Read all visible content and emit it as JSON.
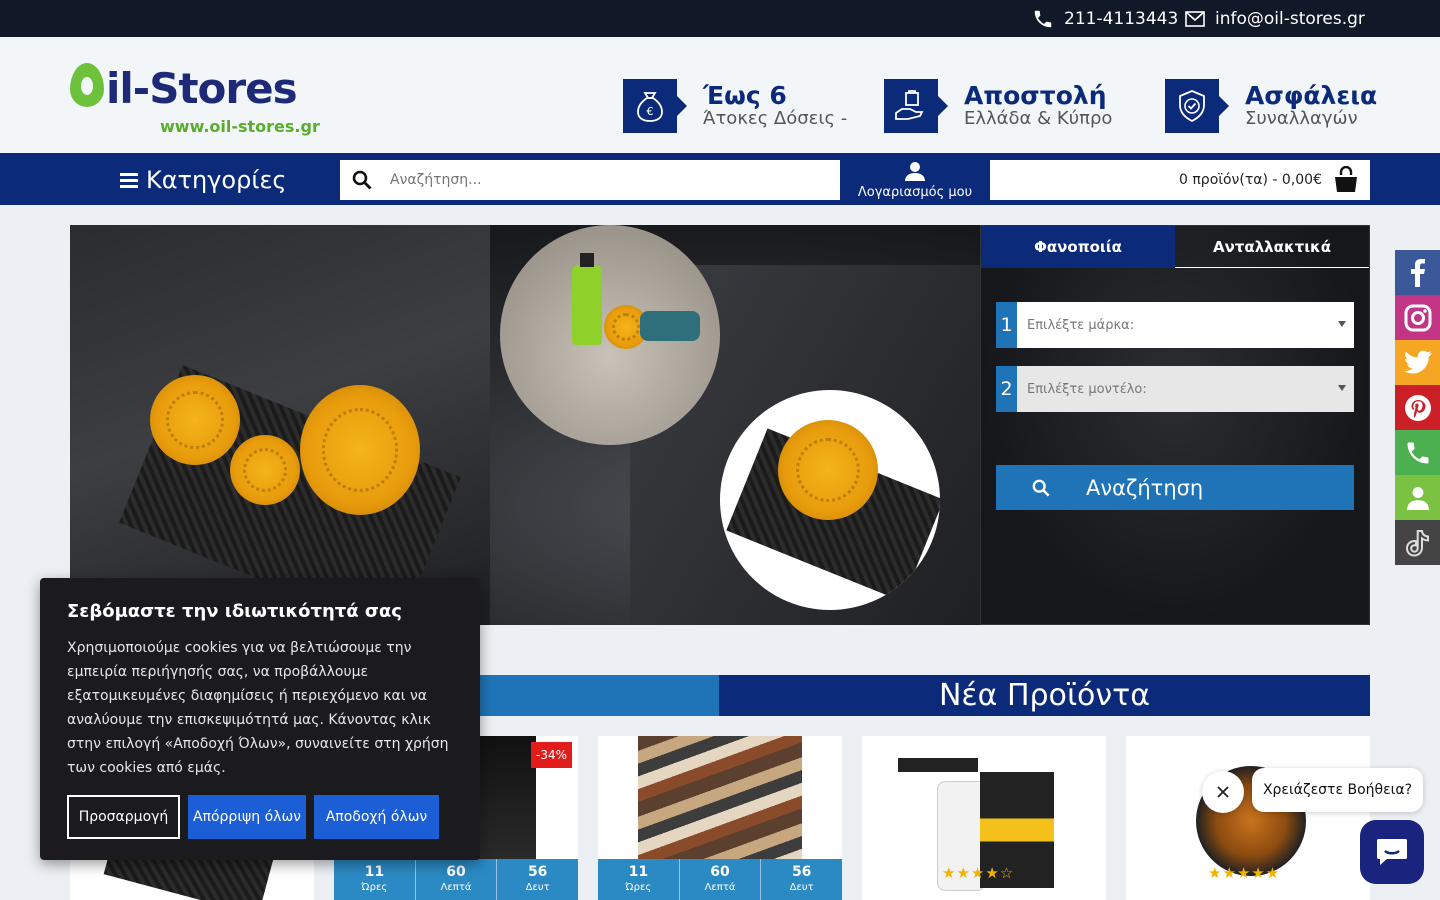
{
  "topbar": {
    "phone": "211-4113443",
    "email": "info@oil-stores.gr",
    "icons": [
      "phone-icon",
      "mail-icon"
    ]
  },
  "logo": {
    "main_text": "il-Stores",
    "url_text": "www.oil-stores.gr"
  },
  "features": [
    {
      "title": "Έως 6",
      "subtitle": "Άτοκες Δόσεις -",
      "icon": "money-bag-icon"
    },
    {
      "title": "Αποστολή",
      "subtitle": "Ελλάδα & Κύπρο",
      "icon": "delivery-hand-icon"
    },
    {
      "title": "Ασφάλεια",
      "subtitle": "Συναλλαγών",
      "icon": "shield-check-icon"
    }
  ],
  "nav": {
    "categories_label": "Κατηγορίες",
    "search_placeholder": "Αναζήτηση...",
    "account_label": "Λογαριασμός μου",
    "cart_label": "0 προϊόν(τα) - 0,00€"
  },
  "selector": {
    "tabs": [
      "Φανοποιία",
      "Ανταλλακτικά"
    ],
    "active_tab": "Φανοποιία",
    "brand_num": "1",
    "brand_placeholder": "Επιλέξτε μάρκα:",
    "model_num": "2",
    "model_placeholder": "Επιλέξτε μοντέλο:",
    "search_label": "Αναζήτηση"
  },
  "social": [
    "facebook-icon",
    "instagram-icon",
    "twitter-icon",
    "pinterest-icon",
    "phone-icon",
    "user-icon",
    "tiktok-icon"
  ],
  "social_colors": [
    "#3b5998",
    "#c13584",
    "#f5a623",
    "#cb2027",
    "#4caf50",
    "#7cc242",
    "#444444"
  ],
  "section": {
    "title": "Νέα Προϊόντα"
  },
  "products": [
    {
      "badge": "",
      "timer": null,
      "stars": ""
    },
    {
      "badge": "-34%",
      "timer": {
        "h": "11",
        "hl": "Ώρες",
        "m": "60",
        "ml": "Λεπτά",
        "s": "56",
        "sl": "Δευτ"
      },
      "stars": ""
    },
    {
      "badge": "",
      "timer": {
        "h": "11",
        "hl": "Ώρες",
        "m": "60",
        "ml": "Λεπτά",
        "s": "56",
        "sl": "Δευτ"
      },
      "stars": ""
    },
    {
      "badge": "",
      "timer": null,
      "stars": "★★★★☆"
    },
    {
      "badge": "",
      "timer": null,
      "stars": "★★★★★"
    }
  ],
  "cookie": {
    "title": "Σεβόμαστε την ιδιωτικότητά σας",
    "text": "Χρησιμοποιούμε cookies για να βελτιώσουμε την εμπειρία περιήγησής σας, να προβάλλουμε εξατομικευμένες διαφημίσεις ή περιεχόμενο και να αναλύουμε την επισκεψιμότητά μας. Κάνοντας κλικ στην επιλογή «Αποδοχή Όλων», συναινείτε στη χρήση των cookies από εμάς.",
    "customize": "Προσαρμογή",
    "reject": "Απόρριψη όλων",
    "accept": "Αποδοχή όλων"
  },
  "chat": {
    "prompt": "Χρειάζεστε Βοήθεια?"
  },
  "colors": {
    "primary": "#0c2a7a",
    "accent": "#1f74b8",
    "green": "#6ec13a",
    "topbar": "#111827",
    "cookie_button": "#1c5ed6"
  }
}
